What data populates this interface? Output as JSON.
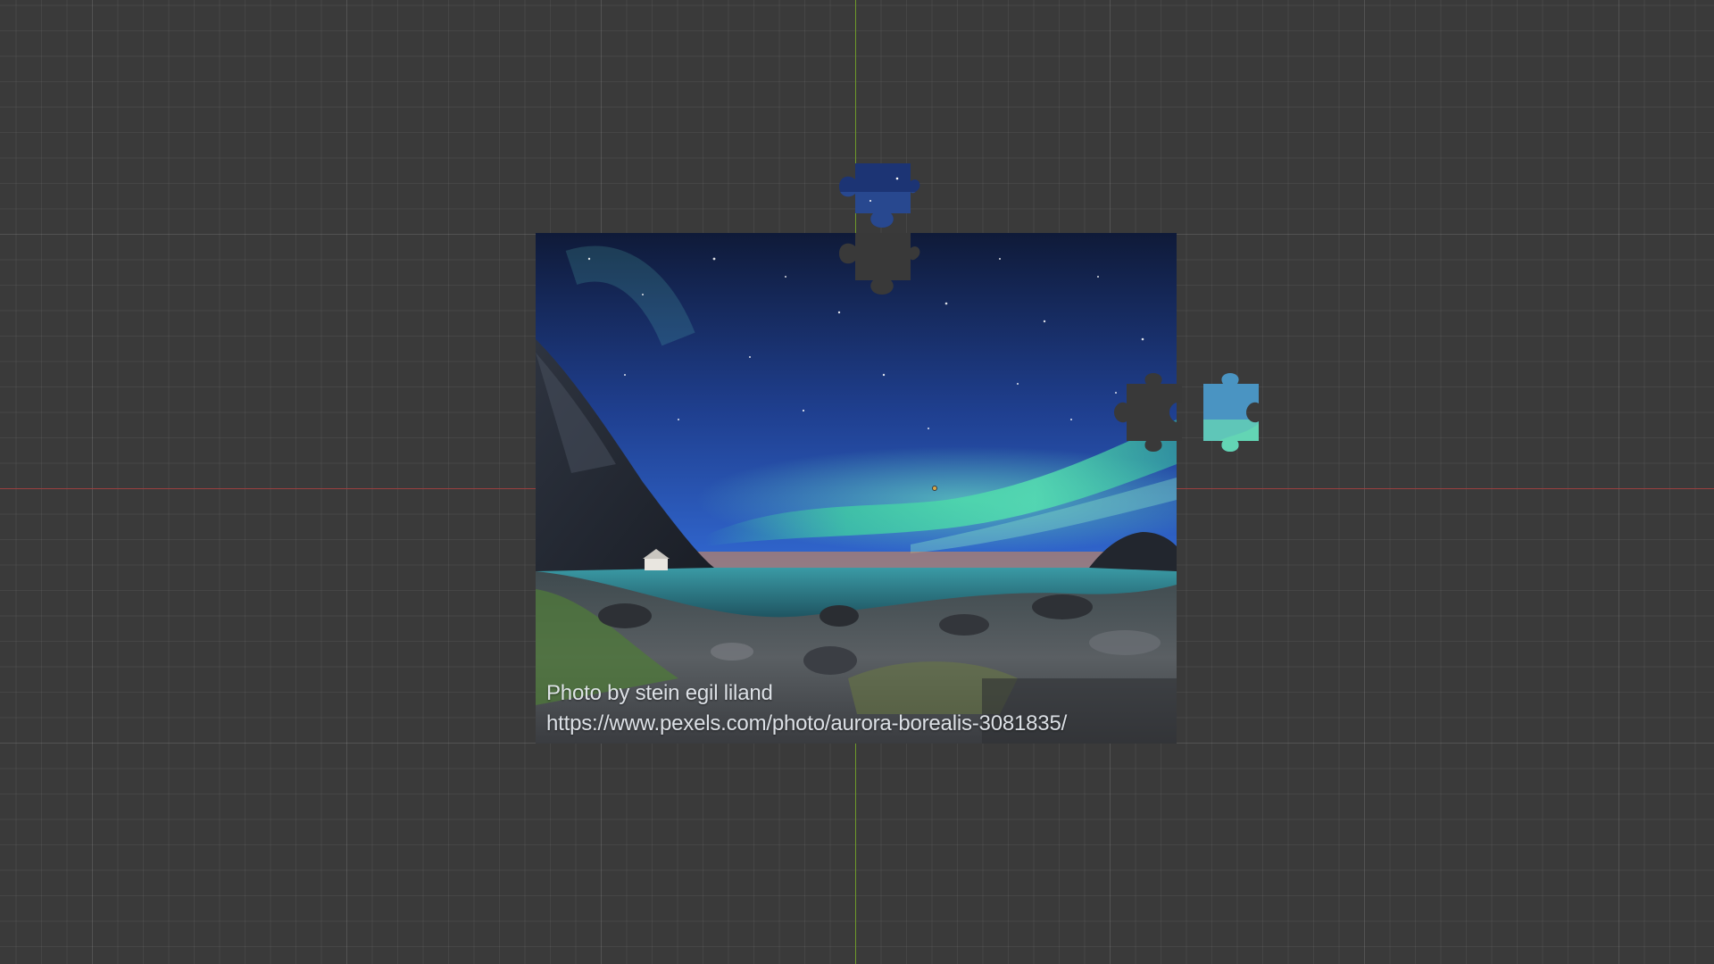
{
  "viewport": {
    "background": "#3a3a3a",
    "axis_x_color": "#9a4040",
    "axis_y_color": "#6f9a2a"
  },
  "puzzle_image": {
    "subject": "aurora-borealis-landscape",
    "caption_line1": "Photo by stein egil liland",
    "caption_line2": "https://www.pexels.com/photo/aurora-borealis-3081835/",
    "colors": {
      "sky_top": "#101c3c",
      "sky_mid": "#2a5bbf",
      "aurora": "#3fd6a0",
      "horizon": "#e38a48",
      "rocks": "#4a4e55"
    }
  },
  "pieces": [
    {
      "name": "loose-piece-top",
      "state": "detached"
    },
    {
      "name": "loose-piece-right",
      "state": "detached"
    }
  ],
  "holes": [
    {
      "name": "empty-slot-top"
    },
    {
      "name": "empty-slot-right"
    }
  ]
}
